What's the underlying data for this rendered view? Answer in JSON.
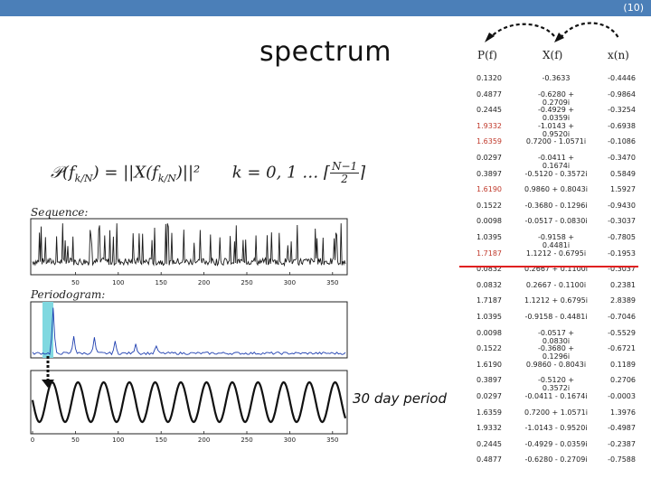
{
  "slide_number": "(10)",
  "title": "spectrum",
  "formula": {
    "lhs": "𝒫(f",
    "lhs_sub": "k/N",
    "mid": ") = ||X(f",
    "mid_sub": "k/N",
    "rhs": ")||²",
    "range": "k = 0, 1 … ⌈",
    "frac_num": "N−1",
    "frac_den": "2",
    "close": "⌉"
  },
  "labels": {
    "sequence": "Sequence:",
    "periodogram": "Periodogram:",
    "annotation": "30 day period"
  },
  "table": {
    "headers": {
      "p": "P(f)",
      "x": "X(f)",
      "xn": "x(n)"
    },
    "rows": [
      {
        "p": "0.1320",
        "x": "-0.3633",
        "xn": "-0.4446",
        "hl": false
      },
      {
        "p": "0.4877",
        "x": "-0.6280 + 0.2709i",
        "xn": "-0.9864",
        "hl": false
      },
      {
        "p": "0.2445",
        "x": "-0.4929 + 0.0359i",
        "xn": "-0.3254",
        "hl": false
      },
      {
        "p": "1.9332",
        "x": "-1.0143 + 0.9520i",
        "xn": "-0.6938",
        "hl": true
      },
      {
        "p": "1.6359",
        "x": "0.7200 - 1.0571i",
        "xn": "-0.1086",
        "hl": true
      },
      {
        "p": "0.0297",
        "x": "-0.0411 + 0.1674i",
        "xn": "-0.3470",
        "hl": false
      },
      {
        "p": "0.3897",
        "x": "-0.5120 - 0.3572i",
        "xn": "0.5849",
        "hl": false
      },
      {
        "p": "1.6190",
        "x": "0.9860 + 0.8043i",
        "xn": "1.5927",
        "hl": true
      },
      {
        "p": "0.1522",
        "x": "-0.3680 - 0.1296i",
        "xn": "-0.9430",
        "hl": false
      },
      {
        "p": "0.0098",
        "x": "-0.0517 - 0.0830i",
        "xn": "-0.3037",
        "hl": false
      },
      {
        "p": "1.0395",
        "x": "-0.9158 + 0.4481i",
        "xn": "-0.7805",
        "hl": false
      },
      {
        "p": "1.7187",
        "x": "1.1212 - 0.6795i",
        "xn": "-0.1953",
        "hl": true
      },
      {
        "p": "0.0832",
        "x": "0.2667 + 0.1100i",
        "xn": "-0.3037",
        "hl": false
      },
      {
        "p": "0.0832",
        "x": "0.2667 - 0.1100i",
        "xn": "0.2381",
        "hl": false
      },
      {
        "p": "1.7187",
        "x": "1.1212 + 0.6795i",
        "xn": "2.8389",
        "hl": false
      },
      {
        "p": "1.0395",
        "x": "-0.9158 - 0.4481i",
        "xn": "-0.7046",
        "hl": false
      },
      {
        "p": "0.0098",
        "x": "-0.0517 + 0.0830i",
        "xn": "-0.5529",
        "hl": false
      },
      {
        "p": "0.1522",
        "x": "-0.3680 + 0.1296i",
        "xn": "-0.6721",
        "hl": false
      },
      {
        "p": "1.6190",
        "x": "0.9860 - 0.8043i",
        "xn": "0.1189",
        "hl": false
      },
      {
        "p": "0.3897",
        "x": "-0.5120 + 0.3572i",
        "xn": "0.2706",
        "hl": false
      },
      {
        "p": "0.0297",
        "x": "-0.0411 - 0.1674i",
        "xn": "-0.0003",
        "hl": false
      },
      {
        "p": "1.6359",
        "x": "0.7200 + 1.0571i",
        "xn": "1.3976",
        "hl": false
      },
      {
        "p": "1.9332",
        "x": "-1.0143 - 0.9520i",
        "xn": "-0.4987",
        "hl": false
      },
      {
        "p": "0.2445",
        "x": "-0.4929 - 0.0359i",
        "xn": "-0.2387",
        "hl": false
      },
      {
        "p": "0.4877",
        "x": "-0.6280 - 0.2709i",
        "xn": "-0.7588",
        "hl": false
      }
    ]
  },
  "plots": {
    "sequence_ticks": [
      "50",
      "100",
      "150",
      "200",
      "250",
      "300",
      "350"
    ],
    "periodogram_ticks": [
      "0",
      "50",
      "100",
      "150",
      "200",
      "250",
      "300",
      "350"
    ]
  },
  "colors": {
    "topbar": "#4b7fb8",
    "highlight": "#80d8e0",
    "red_line": "#e02020",
    "plot_line": "#1a1a1a",
    "periodogram_line": "#1f3fb0"
  }
}
